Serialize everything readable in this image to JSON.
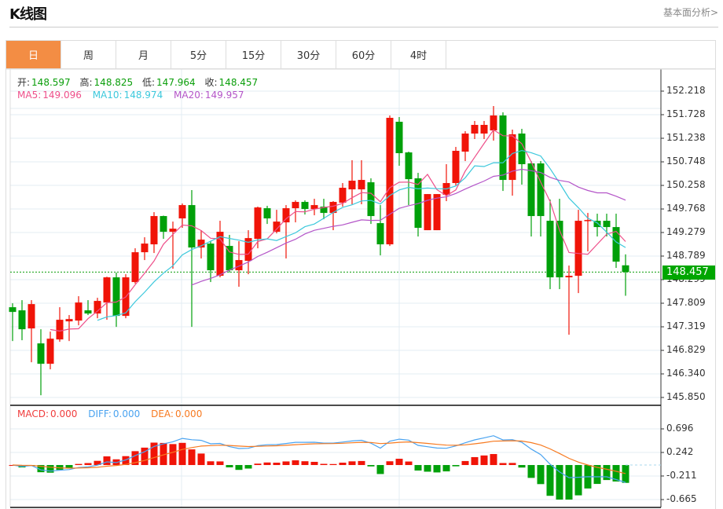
{
  "header": {
    "title": "K线图",
    "more_link": "基本面分析>"
  },
  "tabs": [
    {
      "label": "日",
      "active": true
    },
    {
      "label": "周"
    },
    {
      "label": "月"
    },
    {
      "label": "5分"
    },
    {
      "label": "15分"
    },
    {
      "label": "30分"
    },
    {
      "label": "60分"
    },
    {
      "label": "4时"
    }
  ],
  "ohlc_info": {
    "open_label": "开:",
    "open": "148.597",
    "high_label": "高:",
    "high": "148.825",
    "low_label": "低:",
    "low": "147.964",
    "close_label": "收:",
    "close": "148.457"
  },
  "ma_info": {
    "ma5_label": "MA5:",
    "ma5": "149.096",
    "ma10_label": "MA10:",
    "ma10": "148.974",
    "ma20_label": "MA20:",
    "ma20": "149.957"
  },
  "macd_info": {
    "macd_label": "MACD:",
    "macd": "0.000",
    "diff_label": "DIFF:",
    "diff": "0.000",
    "dea_label": "DEA:",
    "dea": "0.000"
  },
  "colors": {
    "up": "#f01408",
    "down": "#00a00a",
    "ma5": "#ee4f8a",
    "ma10": "#3cc8dc",
    "ma20": "#b455c8",
    "diff": "#4aa3f0",
    "dea": "#f77a20",
    "macd": "#f03c3c"
  },
  "chart_data": {
    "type": "candlestick",
    "price_axis": {
      "ticks": [
        "152.218",
        "151.728",
        "151.238",
        "150.748",
        "150.258",
        "149.768",
        "149.279",
        "148.789",
        "148.299",
        "147.809",
        "147.319",
        "146.829",
        "146.340",
        "145.850"
      ],
      "range": [
        145.85,
        152.218
      ]
    },
    "last_price": "148.457",
    "macd_axis": {
      "ticks": [
        "0.696",
        "0.242",
        "-0.211",
        "-0.665"
      ],
      "range": [
        -0.665,
        0.696
      ]
    },
    "candles_ohlc": [
      [
        147.726,
        147.808,
        147.023,
        147.628
      ],
      [
        147.661,
        147.873,
        147.04,
        147.268
      ],
      [
        147.285,
        147.873,
        146.582,
        147.791
      ],
      [
        146.974,
        147.268,
        145.896,
        146.55
      ],
      [
        146.55,
        147.219,
        146.435,
        147.072
      ],
      [
        147.056,
        147.726,
        147.007,
        147.465
      ],
      [
        147.432,
        147.563,
        147.023,
        147.48
      ],
      [
        147.448,
        147.955,
        147.35,
        147.824
      ],
      [
        147.661,
        147.873,
        147.563,
        147.595
      ],
      [
        147.595,
        147.922,
        147.497,
        147.857
      ],
      [
        147.824,
        148.36,
        147.465,
        148.347
      ],
      [
        148.347,
        148.445,
        147.317,
        147.546
      ],
      [
        147.546,
        148.412,
        147.497,
        148.347
      ],
      [
        148.249,
        148.951,
        148.216,
        148.869
      ],
      [
        148.869,
        149.18,
        148.706,
        149.049
      ],
      [
        149.033,
        149.702,
        148.853,
        149.621
      ],
      [
        149.621,
        149.63,
        149.147,
        149.294
      ],
      [
        149.294,
        149.506,
        148.526,
        149.359
      ],
      [
        149.572,
        149.882,
        149.376,
        149.849
      ],
      [
        149.849,
        150.16,
        147.317,
        148.967
      ],
      [
        148.967,
        149.327,
        148.739,
        149.131
      ],
      [
        149.049,
        149.098,
        148.249,
        148.494
      ],
      [
        148.379,
        149.523,
        148.347,
        149.294
      ],
      [
        149.0,
        149.229,
        148.445,
        148.494
      ],
      [
        148.494,
        149.098,
        148.151,
        148.706
      ],
      [
        148.69,
        149.327,
        148.412,
        149.163
      ],
      [
        149.147,
        149.817,
        148.951,
        149.8
      ],
      [
        149.784,
        149.833,
        149.457,
        149.572
      ],
      [
        149.294,
        149.751,
        149.261,
        149.506
      ],
      [
        149.49,
        149.849,
        148.739,
        149.784
      ],
      [
        149.784,
        149.947,
        149.49,
        149.915
      ],
      [
        149.915,
        149.947,
        149.653,
        149.768
      ],
      [
        149.768,
        149.98,
        149.637,
        149.849
      ],
      [
        149.817,
        149.98,
        149.555,
        149.686
      ],
      [
        149.686,
        149.931,
        149.327,
        149.915
      ],
      [
        149.898,
        150.307,
        149.817,
        150.209
      ],
      [
        150.176,
        150.781,
        149.866,
        150.356
      ],
      [
        150.176,
        150.781,
        149.866,
        150.372
      ],
      [
        150.323,
        150.405,
        149.457,
        149.621
      ],
      [
        149.474,
        149.849,
        148.804,
        149.033
      ],
      [
        149.033,
        151.712,
        149.0,
        151.663
      ],
      [
        151.581,
        151.679,
        150.666,
        150.928
      ],
      [
        150.944,
        150.96,
        149.849,
        150.388
      ],
      [
        150.405,
        150.519,
        149.196,
        149.376
      ],
      [
        149.327,
        150.078,
        149.327,
        150.078
      ],
      [
        149.327,
        150.078,
        149.327,
        150.078
      ],
      [
        150.062,
        150.699,
        149.931,
        150.307
      ],
      [
        150.307,
        151.058,
        150.258,
        150.977
      ],
      [
        150.96,
        151.385,
        150.764,
        151.336
      ],
      [
        151.336,
        151.597,
        151.222,
        151.516
      ],
      [
        151.336,
        151.597,
        151.222,
        151.516
      ],
      [
        151.401,
        151.908,
        151.189,
        151.712
      ],
      [
        151.712,
        151.777,
        150.143,
        150.372
      ],
      [
        150.372,
        151.418,
        150.045,
        151.32
      ],
      [
        151.336,
        151.434,
        150.274,
        150.699
      ],
      [
        150.715,
        150.764,
        149.196,
        149.621
      ],
      [
        150.715,
        150.764,
        149.196,
        149.621
      ],
      [
        149.523,
        149.964,
        148.102,
        148.347
      ],
      [
        149.523,
        149.98,
        148.102,
        148.347
      ],
      [
        148.347,
        148.592,
        147.154,
        148.379
      ],
      [
        148.379,
        149.751,
        148.02,
        149.523
      ],
      [
        149.523,
        149.686,
        148.886,
        149.539
      ],
      [
        149.523,
        149.67,
        149.196,
        149.392
      ],
      [
        149.523,
        149.67,
        149.196,
        149.392
      ],
      [
        149.392,
        149.67,
        148.543,
        148.673
      ],
      [
        148.597,
        148.825,
        147.964,
        148.457
      ]
    ]
  }
}
